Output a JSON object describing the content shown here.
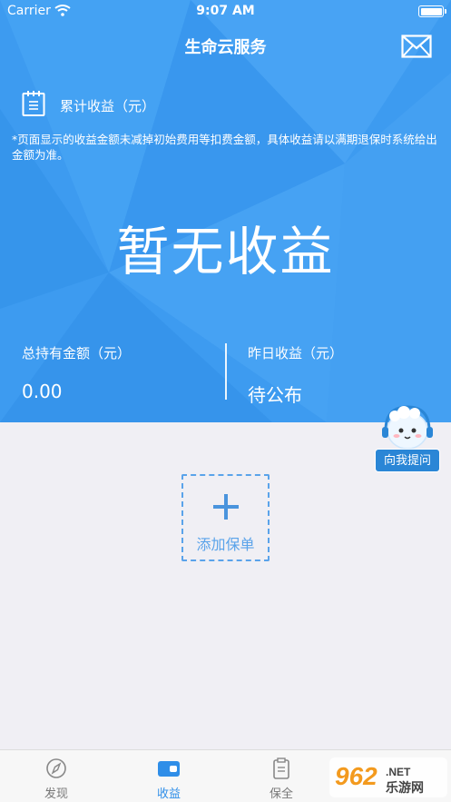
{
  "status_bar": {
    "carrier": "Carrier",
    "time": "9:07 AM"
  },
  "header": {
    "title": "生命云服务"
  },
  "earnings": {
    "cumulative_label": "累计收益（元）",
    "note": "*页面显示的收益金额未减掉初始费用等扣费金额，具体收益请以满期退保时系统给出金额为准。",
    "big_text": "暂无收益"
  },
  "stats": {
    "holding_label": "总持有金额（元）",
    "holding_value": "0.00",
    "yesterday_label": "昨日收益（元）",
    "yesterday_value": "待公布"
  },
  "assistant": {
    "label": "向我提问"
  },
  "add_policy": {
    "label": "添加保单"
  },
  "tabs": [
    {
      "label": "发现",
      "icon": "compass-icon",
      "active": false
    },
    {
      "label": "收益",
      "icon": "wallet-icon",
      "active": true
    },
    {
      "label": "保全",
      "icon": "clipboard-icon",
      "active": false
    }
  ],
  "watermark": {
    "text": "962 乐游网"
  },
  "colors": {
    "primary": "#3d9bf0",
    "active_tab": "#2f8ee8",
    "page_bg": "#f0eff4"
  }
}
